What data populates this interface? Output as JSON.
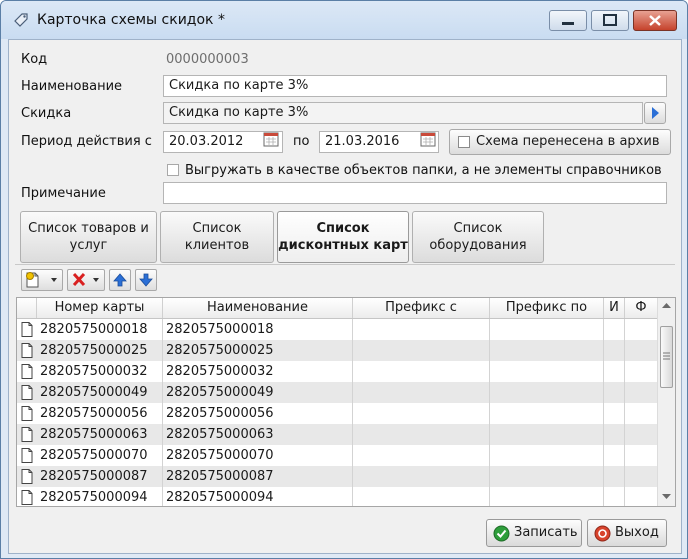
{
  "window": {
    "title": "Карточка схемы скидок *"
  },
  "form": {
    "code_label": "Код",
    "code_value": "0000000003",
    "name_label": "Наименование",
    "name_value": "Скидка по карте 3%",
    "discount_label": "Скидка",
    "discount_value": "Скидка по карте 3%",
    "period_label": "Период действия с",
    "date_from": "20.03.2012",
    "to_label": "по",
    "date_to": "21.03.2016",
    "archive_label": "Схема перенесена в архив",
    "export_label": "Выгружать в качестве объектов папки, а не элементы справочников",
    "note_label": "Примечание",
    "note_value": ""
  },
  "tabs": [
    {
      "line1": "Список товаров и",
      "line2": "услуг"
    },
    {
      "line1": "Список",
      "line2": "клиентов"
    },
    {
      "line1": "Список",
      "line2": "дисконтных карт"
    },
    {
      "line1": "Список",
      "line2": "оборудования"
    }
  ],
  "active_tab": 2,
  "table": {
    "columns": [
      "Номер карты",
      "Наименование",
      "Префикс с",
      "Префикс по",
      "И",
      "Ф"
    ],
    "rows": [
      {
        "card": "2820575000018",
        "name": "2820575000018"
      },
      {
        "card": "2820575000025",
        "name": "2820575000025"
      },
      {
        "card": "2820575000032",
        "name": "2820575000032"
      },
      {
        "card": "2820575000049",
        "name": "2820575000049"
      },
      {
        "card": "2820575000056",
        "name": "2820575000056"
      },
      {
        "card": "2820575000063",
        "name": "2820575000063"
      },
      {
        "card": "2820575000070",
        "name": "2820575000070"
      },
      {
        "card": "2820575000087",
        "name": "2820575000087"
      },
      {
        "card": "2820575000094",
        "name": "2820575000094"
      }
    ]
  },
  "buttons": {
    "save_label": "Записать",
    "exit_label": "Выход"
  },
  "colors": {
    "accent": "#2b6fd6",
    "save_icon": "#2e9e3b",
    "exit_icon": "#d8432c",
    "delete_icon": "#d92020"
  }
}
